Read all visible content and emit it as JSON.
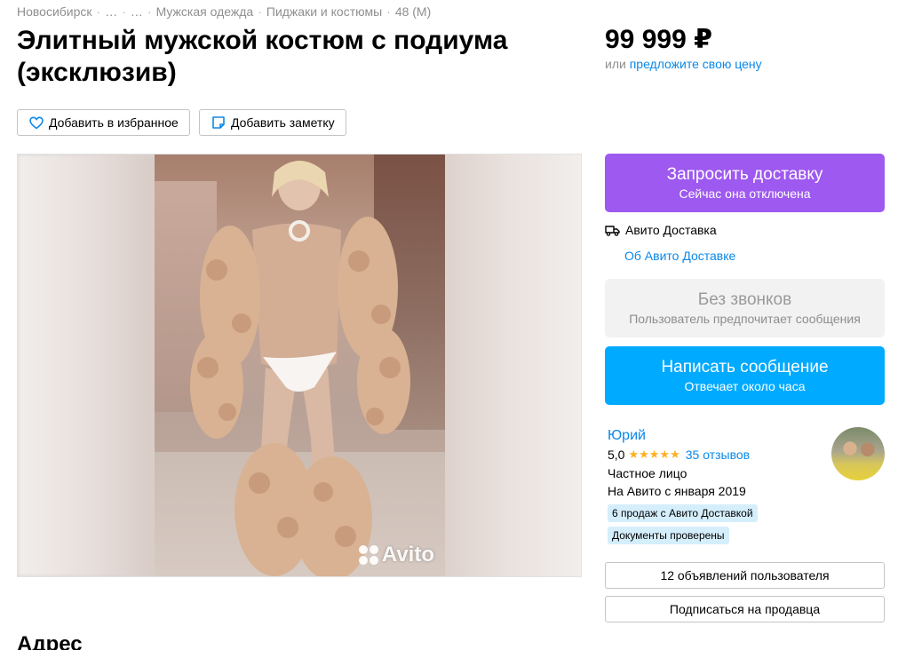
{
  "breadcrumb": [
    "Новосибирск",
    "…",
    "…",
    "Мужская одежда",
    "Пиджаки и костюмы",
    "48 (M)"
  ],
  "title": "Элитный мужской костюм с подиума (эксклюзив)",
  "price": {
    "value": "99 999 ₽",
    "or": "или",
    "offer_link": "предложите свою цену"
  },
  "actions": {
    "favorite_label": "Добавить в избранное",
    "note_label": "Добавить заметку"
  },
  "gallery": {
    "watermark": "Avito"
  },
  "delivery": {
    "button_label": "Запросить доставку",
    "button_sub": "Сейчас она отключена",
    "service_label": "Авито Доставка",
    "about_link": "Об Авито Доставке"
  },
  "calls": {
    "label": "Без звонков",
    "sub": "Пользователь предпочитает сообщения"
  },
  "message": {
    "label": "Написать сообщение",
    "sub": "Отвечает около часа"
  },
  "seller": {
    "name": "Юрий",
    "rating": "5,0",
    "stars": "★★★★★",
    "reviews": "35 отзывов",
    "type": "Частное лицо",
    "since": "На Авито с января 2019",
    "badges": [
      "6 продаж с Авито Доставкой",
      "Документы проверены"
    ]
  },
  "seller_actions": {
    "ads_label": "12 объявлений пользователя",
    "subscribe_label": "Подписаться на продавца"
  },
  "section": {
    "address_title": "Адрес"
  },
  "colors": {
    "accent_blue": "#00aaff",
    "link_blue": "#0a88e8",
    "delivery_purple": "#9e59f0",
    "star_orange": "#ffb021"
  }
}
